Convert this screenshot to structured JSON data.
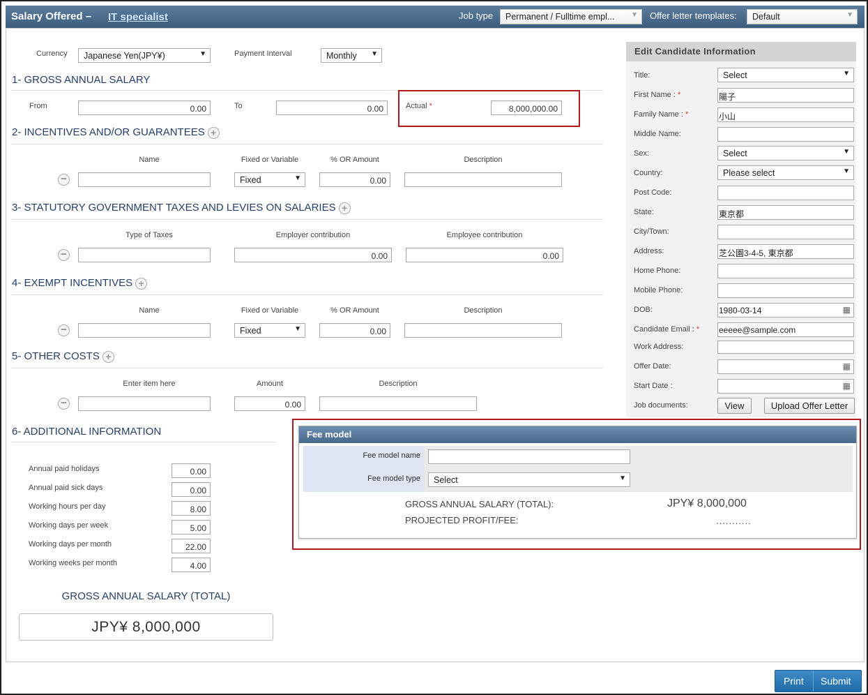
{
  "header": {
    "title": "Salary Offered –",
    "job_link": "IT specialist",
    "job_type_label": "Job type",
    "job_type_value": "Permanent / Fulltime empl...",
    "templates_label": "Offer letter templates:",
    "templates_value": "Default"
  },
  "top": {
    "currency_label": "Currency",
    "currency_value": "Japanese Yen(JPY¥)",
    "interval_label": "Payment Interval",
    "interval_value": "Monthly"
  },
  "sec1": {
    "title": "1- GROSS ANNUAL SALARY",
    "from_label": "From",
    "from_value": "0.00",
    "to_label": "To",
    "to_value": "0.00",
    "actual_label": "Actual",
    "required_mark": "*",
    "actual_value": "8,000,000.00"
  },
  "sec2": {
    "title": "2- INCENTIVES AND/OR GUARANTEES",
    "col_name": "Name",
    "col_fixed": "Fixed or Variable",
    "col_amount": "% OR Amount",
    "col_desc": "Description",
    "fixed_value": "Fixed",
    "amount_value": "0.00"
  },
  "sec3": {
    "title": "3- STATUTORY GOVERNMENT TAXES AND LEVIES ON SALARIES",
    "col_type": "Type of Taxes",
    "col_employer": "Employer contribution",
    "col_employee": "Employee contribution",
    "employer_value": "0.00",
    "employee_value": "0.00"
  },
  "sec4": {
    "title": "4- EXEMPT INCENTIVES",
    "col_name": "Name",
    "col_fixed": "Fixed or Variable",
    "col_amount": "% OR Amount",
    "col_desc": "Description",
    "fixed_value": "Fixed",
    "amount_value": "0.00"
  },
  "sec5": {
    "title": "5- OTHER COSTS",
    "col_item": "Enter item here",
    "col_amount": "Amount",
    "col_desc": "Description",
    "amount_value": "0.00"
  },
  "sec6": {
    "title": "6- ADDITIONAL INFORMATION",
    "rows": [
      {
        "label": "Annual paid holidays",
        "value": "0.00"
      },
      {
        "label": "Annual paid sick days",
        "value": "0.00"
      },
      {
        "label": "Working hours per day",
        "value": "8.00"
      },
      {
        "label": "Working days per week",
        "value": "5.00"
      },
      {
        "label": "Working days per month",
        "value": "22.00"
      },
      {
        "label": "Working weeks per month",
        "value": "4.00"
      }
    ],
    "total_label": "GROSS ANNUAL SALARY (TOTAL)",
    "total_value": "JPY¥ 8,000,000"
  },
  "candidate": {
    "title": "Edit Candidate Information",
    "required_mark": "*",
    "title_label": "Title:",
    "title_value": "Select",
    "first_label": "First Name :",
    "first_value": "陽子",
    "family_label": "Family Name :",
    "family_value": "小山",
    "middle_label": "Middle Name:",
    "middle_value": "",
    "sex_label": "Sex:",
    "sex_value": "Select",
    "country_label": "Country:",
    "country_value": "Please select",
    "post_label": "Post Code:",
    "post_value": "",
    "state_label": "State:",
    "state_value": "東京都",
    "city_label": "City/Town:",
    "city_value": "",
    "address_label": "Address:",
    "address_value": "芝公園3-4-5, 東京都",
    "home_label": "Home Phone:",
    "home_value": "",
    "mobile_label": "Mobile Phone:",
    "mobile_value": "",
    "dob_label": "DOB:",
    "dob_value": "1980-03-14",
    "email_label": "Candidate Email :",
    "email_value": "eeeee@sample.com",
    "work_label": "Work Address:",
    "work_value": "",
    "offer_label": "Offer Date:",
    "offer_value": "",
    "start_label": "Start Date :",
    "start_value": "",
    "docs_label": "Job documents:",
    "view_button": "View",
    "upload_button": "Upload Offer Letter"
  },
  "fee": {
    "title": "Fee model",
    "name_label": "Fee model name",
    "name_value": "",
    "type_label": "Fee model type",
    "type_value": "Select",
    "total_label": "GROSS ANNUAL SALARY (TOTAL):",
    "total_value": "JPY¥ 8,000,000",
    "profit_label": "PROJECTED PROFIT/FEE:",
    "profit_value": "..........."
  },
  "footer": {
    "print_label": "Print",
    "submit_label": "Submit"
  }
}
